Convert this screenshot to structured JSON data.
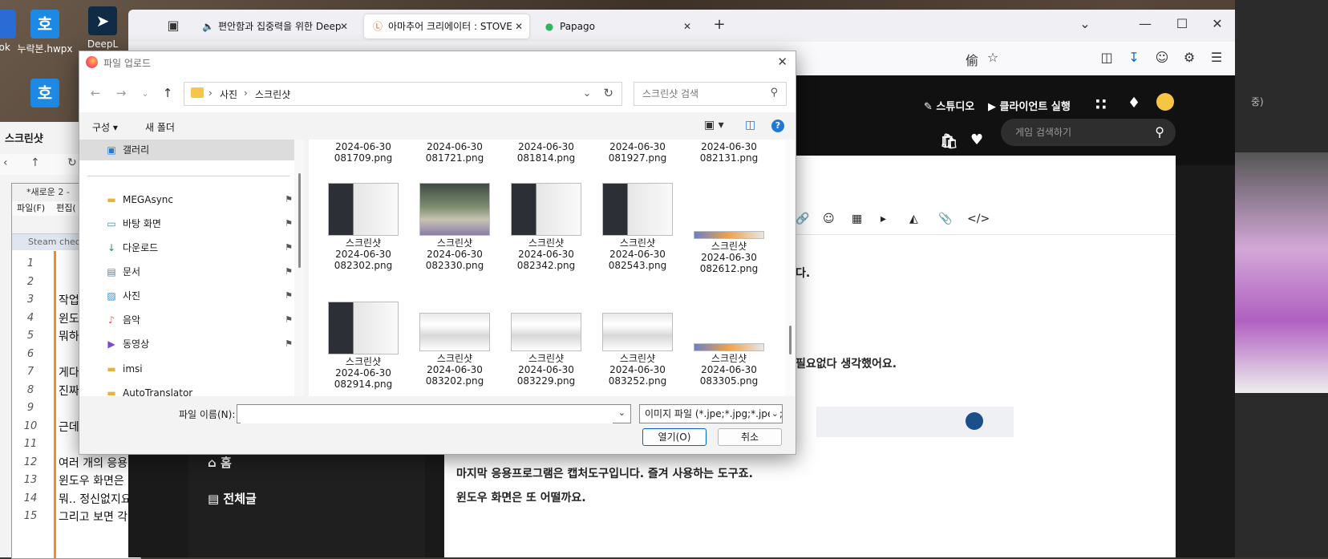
{
  "desktop": {
    "icons": [
      {
        "label": "ook"
      },
      {
        "label": "누락본.hwpx",
        "glyph": "호"
      },
      {
        "label": "DeepL"
      },
      {
        "glyph": "호"
      }
    ]
  },
  "explorer_bg": {
    "title": "스크린샷"
  },
  "notepad": {
    "title": "*새로운 2 -",
    "menu": [
      "파일(F)",
      "편집("
    ],
    "tab": "Steam check",
    "line_numbers": [
      "1",
      "2",
      "3",
      "4",
      "5",
      "6",
      "7",
      "8",
      "9",
      "10",
      "11",
      "12",
      "13",
      "14",
      "15"
    ],
    "lines": [
      {
        "n": 3,
        "text": "작업"
      },
      {
        "n": 4,
        "text": "윈도"
      },
      {
        "n": 5,
        "text": "뭐하"
      },
      {
        "n": 7,
        "text": "게다"
      },
      {
        "n": 8,
        "text": "진짜"
      },
      {
        "n": 10,
        "text": "근데"
      },
      {
        "n": 12,
        "text": "여러 개의 응용"
      },
      {
        "n": 13,
        "text": "윈도우 화면은"
      },
      {
        "n": 14,
        "text": "뭐.. 정신없지요"
      },
      {
        "n": 15,
        "text": "그리고 보면 각"
      }
    ]
  },
  "browser": {
    "tabs": [
      {
        "label": "편안함과 집중력을 위한 Deep",
        "icon": "speaker-icon",
        "active": false
      },
      {
        "label": "아마추어 크리에이터 : STOVE",
        "icon": "stove-icon",
        "active": true
      },
      {
        "label": "Papago",
        "icon": "papago-icon",
        "active": false
      }
    ],
    "new_tab": "+",
    "header": {
      "studio": "스튜디오",
      "client": "클라이언트 실행"
    },
    "game_search_placeholder": "게임 검색하기",
    "sidebar": [
      "홈",
      "전체글"
    ],
    "post_lines": [
      "다.",
      "필요없다 생각했어요.",
      "마지막 응용프로그램은 캡처도구입니다. 즐겨 사용하는 도구죠.",
      "윈도우 화면은 또 어떨까요."
    ]
  },
  "right_strip": {
    "text": "중)"
  },
  "dialog": {
    "title": "파일 업로드",
    "breadcrumb": [
      "사진",
      "스크린샷"
    ],
    "search_placeholder": "스크린샷 검색",
    "commands": {
      "organize": "구성",
      "new_folder": "새 폴더"
    },
    "nav_items": [
      {
        "label": "갤러리",
        "icon": "gallery-icon",
        "pinned": false,
        "selected": true
      },
      {
        "label": "MEGAsync",
        "icon": "folder-icon",
        "pinned": true
      },
      {
        "label": "바탕 화면",
        "icon": "desktop-icon",
        "pinned": true
      },
      {
        "label": "다운로드",
        "icon": "download-icon",
        "pinned": true
      },
      {
        "label": "문서",
        "icon": "document-icon",
        "pinned": true
      },
      {
        "label": "사진",
        "icon": "pictures-icon",
        "pinned": true
      },
      {
        "label": "음악",
        "icon": "music-icon",
        "pinned": true
      },
      {
        "label": "동영상",
        "icon": "video-icon",
        "pinned": true
      },
      {
        "label": "imsi",
        "icon": "folder-icon",
        "pinned": false
      },
      {
        "label": "AutoTranslator",
        "icon": "folder-icon",
        "pinned": false
      }
    ],
    "files": [
      {
        "name": "",
        "date": "2024-06-30",
        "time": "081709.png",
        "thumb": "none"
      },
      {
        "name": "",
        "date": "2024-06-30",
        "time": "081721.png",
        "thumb": "none"
      },
      {
        "name": "",
        "date": "2024-06-30",
        "time": "081814.png",
        "thumb": "none"
      },
      {
        "name": "",
        "date": "2024-06-30",
        "time": "081927.png",
        "thumb": "none"
      },
      {
        "name": "",
        "date": "2024-06-30",
        "time": "082131.png",
        "thumb": "none"
      },
      {
        "name": "스크린샷",
        "date": "2024-06-30",
        "time": "082302.png",
        "thumb": "dark"
      },
      {
        "name": "스크린샷",
        "date": "2024-06-30",
        "time": "082330.png",
        "thumb": "photo"
      },
      {
        "name": "스크린샷",
        "date": "2024-06-30",
        "time": "082342.png",
        "thumb": "dark"
      },
      {
        "name": "스크린샷",
        "date": "2024-06-30",
        "time": "082543.png",
        "thumb": "dark"
      },
      {
        "name": "스크린샷",
        "date": "2024-06-30",
        "time": "082612.png",
        "thumb": "strip"
      },
      {
        "name": "스크린샷",
        "date": "2024-06-30",
        "time": "082914.png",
        "thumb": "dark"
      },
      {
        "name": "스크린샷",
        "date": "2024-06-30",
        "time": "083202.png",
        "thumb": "wide"
      },
      {
        "name": "스크린샷",
        "date": "2024-06-30",
        "time": "083229.png",
        "thumb": "wide"
      },
      {
        "name": "스크린샷",
        "date": "2024-06-30",
        "time": "083252.png",
        "thumb": "wide"
      },
      {
        "name": "스크린샷",
        "date": "2024-06-30",
        "time": "083305.png",
        "thumb": "strip"
      }
    ],
    "filename_label": "파일 이름(N):",
    "filename_value": "",
    "filter": "이미지 파일 (*.jpe;*.jpg;*.jpeg;*",
    "open_label": "열기(O)",
    "cancel_label": "취소"
  },
  "colors": {
    "accent": "#0067c0",
    "stove_orange": "#f26522",
    "notepad_gutter": "#f28c28"
  }
}
